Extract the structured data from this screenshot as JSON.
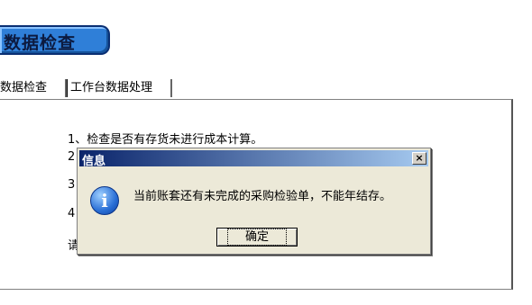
{
  "header": {
    "title": "数据检查"
  },
  "tabs": [
    {
      "label": "数据检查"
    },
    {
      "label": "工作台数据处理"
    }
  ],
  "check_list": {
    "line1": "1、检查是否有存货未进行成本计算。",
    "line2": "2",
    "line3": "3",
    "line4": "4",
    "line5": "请"
  },
  "dialog": {
    "title": "信息",
    "close_symbol": "×",
    "icon_glyph": "i",
    "message": "当前账套还有未完成的采购检验单，不能年结存。",
    "ok_label": "确定"
  }
}
